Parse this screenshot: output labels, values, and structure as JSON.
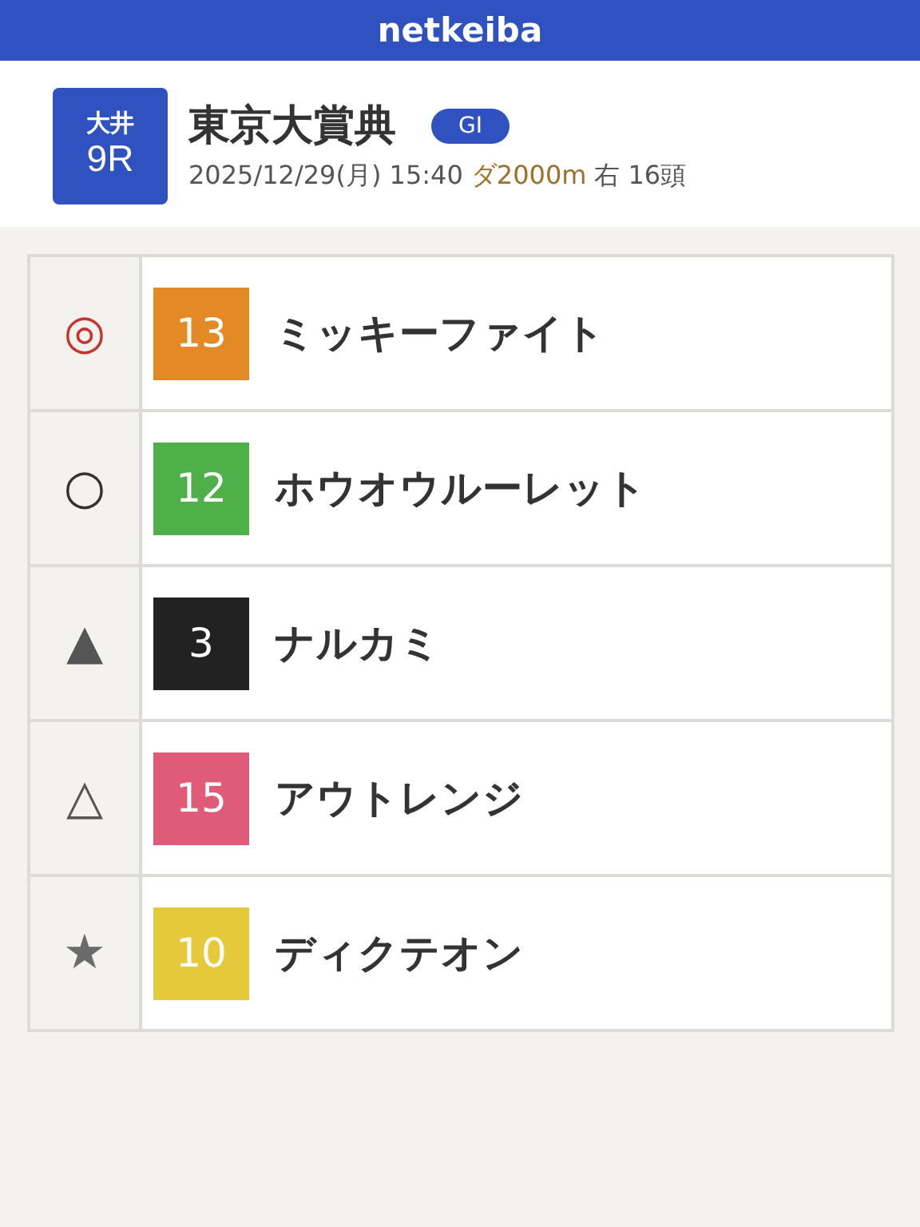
{
  "header": {
    "logo": "netkeiba"
  },
  "race": {
    "venue": "大井",
    "number": "9R",
    "name": "東京大賞典",
    "grade": "GI",
    "date_time": "2025/12/29(月) 15:40",
    "course": "ダ2000m",
    "direction": "右",
    "runners": "16頭"
  },
  "picks": [
    {
      "mark": "◎",
      "kind": "primary",
      "horse_number": "13",
      "color": "#e38a27",
      "horse_name": "ミッキーファイト"
    },
    {
      "mark": "○",
      "kind": "outline",
      "horse_number": "12",
      "color": "#4fb04a",
      "horse_name": "ホウオウルーレット"
    },
    {
      "mark": "▲",
      "kind": "solid",
      "horse_number": "3",
      "color": "#222222",
      "horse_name": "ナルカミ"
    },
    {
      "mark": "△",
      "kind": "solid",
      "horse_number": "15",
      "color": "#e05b78",
      "horse_name": "アウトレンジ"
    },
    {
      "mark": "★",
      "kind": "muted",
      "horse_number": "10",
      "color": "#e6c93a",
      "horse_name": "ディクテオン"
    }
  ]
}
